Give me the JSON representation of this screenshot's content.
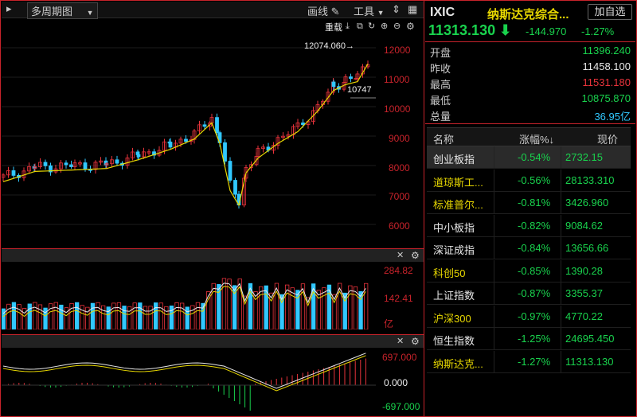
{
  "toolbar": {
    "period_label": "多周期图",
    "draw_label": "画线",
    "tools_label": "工具",
    "reload_label": "重载"
  },
  "price_axis": [
    "12000",
    "11000",
    "10000",
    "9000",
    "8000",
    "7000",
    "6000"
  ],
  "price_annotations": {
    "high": "12074.060→",
    "low_of_recent": "10747"
  },
  "volume_axis": [
    "284.82",
    "142.41",
    "亿"
  ],
  "macd_axis": [
    "697.000",
    "0.000",
    "-697.000"
  ],
  "quote": {
    "code": "IXIC",
    "name": "纳斯达克综合...",
    "add_label": "加自选",
    "price": "11313.130",
    "change": "-144.970",
    "change_pct": "-1.27%",
    "stats": [
      {
        "key": "开盘",
        "value": "11396.240",
        "color": "#19d24d"
      },
      {
        "key": "昨收",
        "value": "11458.100",
        "color": "#e8e8e8"
      },
      {
        "key": "最高",
        "value": "11531.180",
        "color": "#e8333b"
      },
      {
        "key": "最低",
        "value": "10875.870",
        "color": "#19d24d"
      },
      {
        "key": "总量",
        "value": "36.95亿",
        "color": "#31c8ff"
      }
    ]
  },
  "table": {
    "headers": [
      "名称",
      "涨幅%↓",
      "现价"
    ],
    "rows": [
      {
        "name": "创业板指",
        "chg": "-0.54%",
        "price": "2732.15",
        "name_color": "#e8e8e8"
      },
      {
        "name": "道琼斯工...",
        "chg": "-0.56%",
        "price": "28133.310",
        "name_color": "#e8d800"
      },
      {
        "name": "标准普尔...",
        "chg": "-0.81%",
        "price": "3426.960",
        "name_color": "#e8d800"
      },
      {
        "name": "中小板指",
        "chg": "-0.82%",
        "price": "9084.62",
        "name_color": "#e8e8e8"
      },
      {
        "name": "深证成指",
        "chg": "-0.84%",
        "price": "13656.66",
        "name_color": "#e8e8e8"
      },
      {
        "name": "科创50",
        "chg": "-0.85%",
        "price": "1390.28",
        "name_color": "#e8d800"
      },
      {
        "name": "上证指数",
        "chg": "-0.87%",
        "price": "3355.37",
        "name_color": "#e8e8e8"
      },
      {
        "name": "沪深300",
        "chg": "-0.97%",
        "price": "4770.22",
        "name_color": "#e8d800"
      },
      {
        "name": "恒生指数",
        "chg": "-1.25%",
        "price": "24695.450",
        "name_color": "#e8e8e8"
      },
      {
        "name": "纳斯达克...",
        "chg": "-1.27%",
        "price": "11313.130",
        "name_color": "#e8d800"
      }
    ]
  },
  "colors": {
    "up": "#e8333b",
    "down": "#31c8ff",
    "green": "#19d24d",
    "ma": "#e8d800",
    "frame": "#c8232b"
  }
}
